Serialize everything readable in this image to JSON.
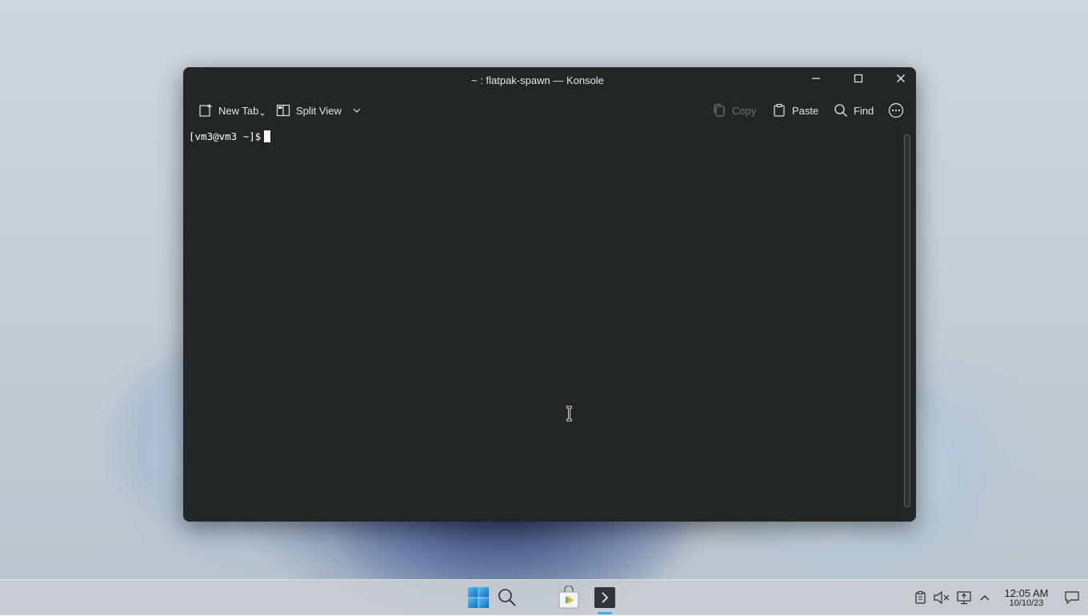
{
  "window": {
    "title": "~ : flatpak-spawn — Konsole",
    "controls": [
      "minimize-icon",
      "maximize-icon",
      "close-icon"
    ]
  },
  "toolbar": {
    "new_tab_label": "New Tab",
    "split_view_label": "Split View",
    "copy_label": "Copy",
    "paste_label": "Paste",
    "find_label": "Find"
  },
  "terminal": {
    "prompt": "[vm3@vm3 ~]$"
  },
  "taskbar": {
    "apps": [
      "start-menu-icon",
      "search-icon",
      "store-icon",
      "terminal-icon"
    ],
    "tray": [
      "clipboard-icon",
      "volume-muted-icon",
      "network-icon",
      "expand-tray-icon"
    ],
    "clock_time": "12:05 AM",
    "clock_date": "10/10/23"
  },
  "colors": {
    "window_bg": "#232627",
    "text": "#e3e6e8",
    "accent": "#3daee9"
  }
}
